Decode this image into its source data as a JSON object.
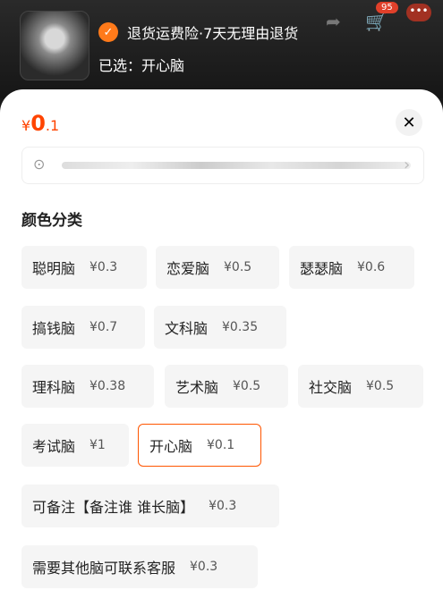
{
  "header": {
    "guarantee_text": "退货运费险·7天无理由退货",
    "selected_text": "已选：开心脑",
    "cart_count": "95"
  },
  "sheet": {
    "price_symbol": "¥",
    "price_int": "0",
    "price_dec": ".1",
    "section_title": "颜色分类"
  },
  "options": [
    {
      "name": "聪明脑",
      "price": "¥0.3"
    },
    {
      "name": "恋爱脑",
      "price": "¥0.5"
    },
    {
      "name": "瑟瑟脑",
      "price": "¥0.6"
    },
    {
      "name": "搞钱脑",
      "price": "¥0.7"
    },
    {
      "name": "文科脑",
      "price": "¥0.35"
    },
    {
      "name": "理科脑",
      "price": "¥0.38"
    },
    {
      "name": "艺术脑",
      "price": "¥0.5"
    },
    {
      "name": "社交脑",
      "price": "¥0.5"
    },
    {
      "name": "考试脑",
      "price": "¥1"
    },
    {
      "name": "开心脑",
      "price": "¥0.1"
    },
    {
      "name": "可备注【备注谁 谁长脑】",
      "price": "¥0.3"
    },
    {
      "name": "需要其他脑可联系客服",
      "price": "¥0.3"
    }
  ],
  "colors": {
    "accent": "#ff5500",
    "price": "#ff4400"
  }
}
